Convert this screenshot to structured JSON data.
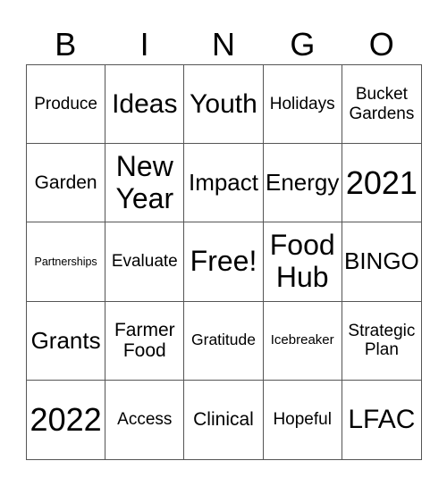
{
  "header": [
    "B",
    "I",
    "N",
    "G",
    "O"
  ],
  "cells": [
    "Produce",
    "Ideas",
    "Youth",
    "Holidays",
    "Bucket Gardens",
    "Garden",
    "New Year",
    "Impact",
    "Energy",
    "2021",
    "Partnerships",
    "Evaluate",
    "Free!",
    "Food Hub",
    "BINGO",
    "Grants",
    "Farmer Food",
    "Gratitude",
    "Icebreaker",
    "Strategic Plan",
    "2022",
    "Access",
    "Clinical",
    "Hopeful",
    "LFAC"
  ]
}
